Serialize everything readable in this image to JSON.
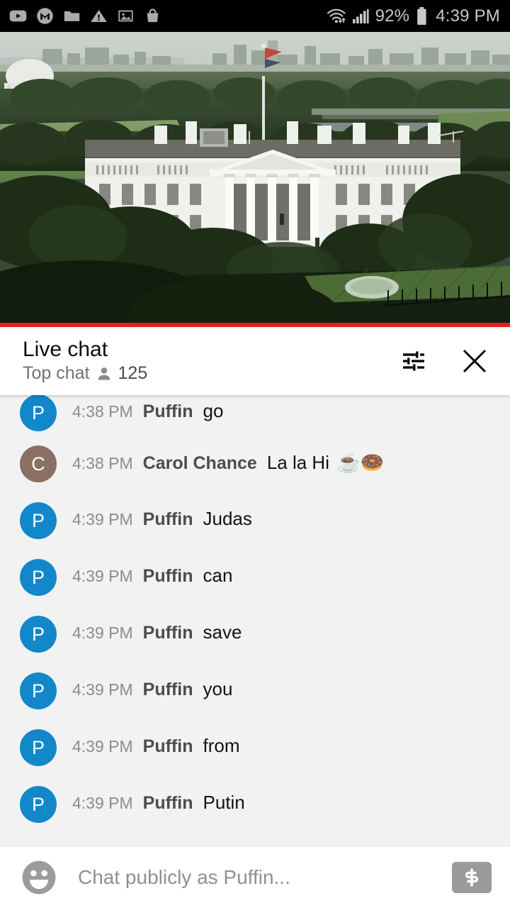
{
  "statusbar": {
    "icons": [
      "youtube-icon",
      "gmail-icon",
      "folder-icon",
      "warning-icon",
      "photo-icon",
      "shopping-bag-icon"
    ],
    "wifi_icon": "wifi-icon",
    "signal_icon": "cellular-signal-icon",
    "battery_percent": "92%",
    "battery_icon": "battery-full-icon",
    "time": "4:39 PM"
  },
  "video": {
    "description": "White House live stream with Jefferson Memorial and Washington DC skyline",
    "progress_percent": 100,
    "progress_color": "#ec1c1c"
  },
  "chat_header": {
    "title": "Live chat",
    "subtitle": "Top chat",
    "viewer_icon": "person-icon",
    "viewer_count": "125",
    "settings_icon": "chat-filter-icon",
    "close_icon": "close-icon"
  },
  "messages": [
    {
      "time": "4:38 PM",
      "author": "Puffin",
      "text": "go",
      "emoji": "",
      "initial": "P",
      "color": "#1287c9"
    },
    {
      "time": "4:38 PM",
      "author": "Carol Chance",
      "text": "La la Hi",
      "emoji": "☕🍩",
      "initial": "C",
      "color": "#8a6f62"
    },
    {
      "time": "4:39 PM",
      "author": "Puffin",
      "text": "Judas",
      "emoji": "",
      "initial": "P",
      "color": "#1287c9"
    },
    {
      "time": "4:39 PM",
      "author": "Puffin",
      "text": "can",
      "emoji": "",
      "initial": "P",
      "color": "#1287c9"
    },
    {
      "time": "4:39 PM",
      "author": "Puffin",
      "text": "save",
      "emoji": "",
      "initial": "P",
      "color": "#1287c9"
    },
    {
      "time": "4:39 PM",
      "author": "Puffin",
      "text": "you",
      "emoji": "",
      "initial": "P",
      "color": "#1287c9"
    },
    {
      "time": "4:39 PM",
      "author": "Puffin",
      "text": "from",
      "emoji": "",
      "initial": "P",
      "color": "#1287c9"
    },
    {
      "time": "4:39 PM",
      "author": "Puffin",
      "text": "Putin",
      "emoji": "",
      "initial": "P",
      "color": "#1287c9"
    }
  ],
  "input_bar": {
    "emoji_icon": "emoji-smiley-icon",
    "value": "",
    "placeholder": "Chat publicly as Puffin...",
    "superchat_icon": "dollar-sign-icon"
  }
}
